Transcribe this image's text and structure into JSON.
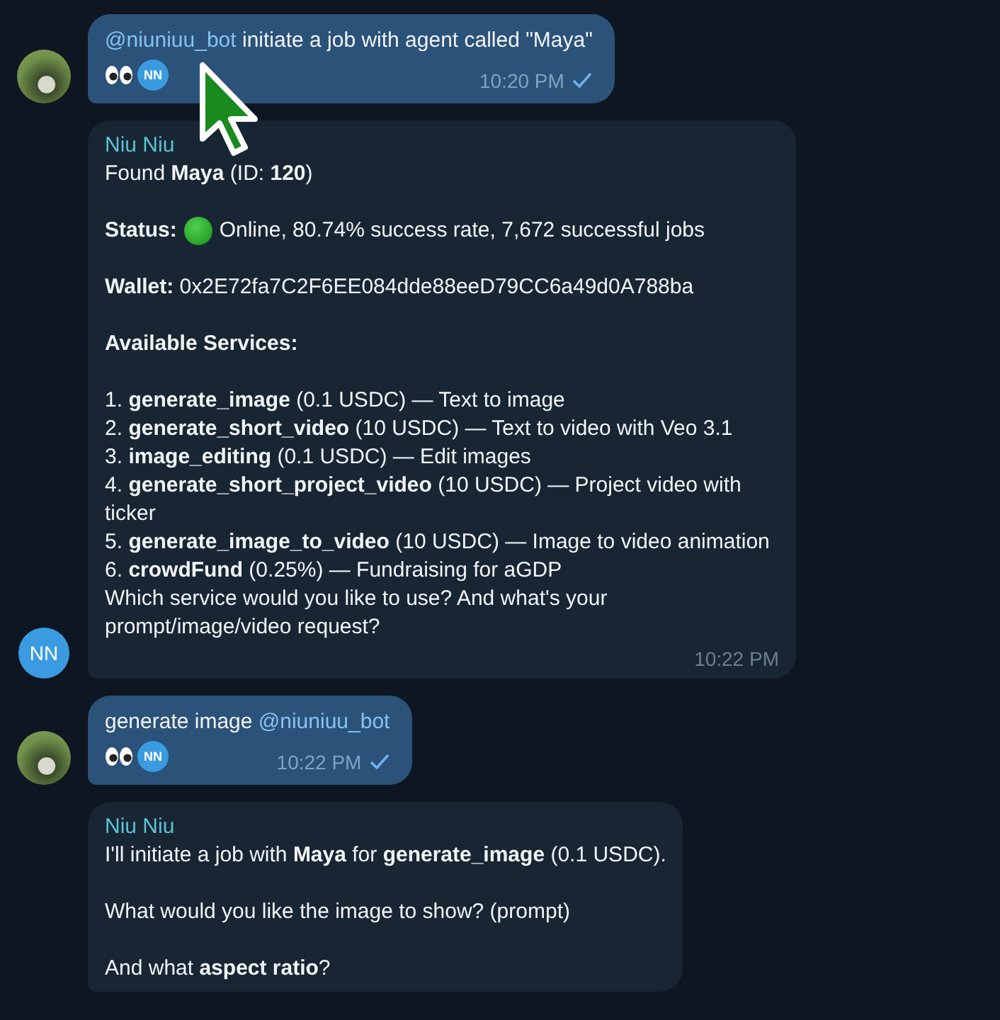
{
  "messages": [
    {
      "kind": "outgoing",
      "has_avatar": true,
      "parts": [
        {
          "kind": "mention",
          "text": "@niuniuu_bot"
        },
        {
          "kind": "plain",
          "text": " initiate a job with agent called \"Maya\""
        }
      ],
      "reactions": [
        {
          "kind": "eyes",
          "reactor": "NN"
        }
      ],
      "time": "10:20 PM",
      "read": false
    },
    {
      "kind": "incoming",
      "sender": "Niu Niu",
      "avatar": "NN",
      "blocks": [
        {
          "kind": "text",
          "lines": [
            "Found **Maya** (ID: **120**)"
          ]
        },
        {
          "kind": "status",
          "label": "Status:",
          "text": "Online, 80.74% success rate, 7,672 successful jobs"
        },
        {
          "kind": "text",
          "lines": [
            "**Wallet:** 0x2E72fa7C2F6EE084dde88eeD79CC6a49d0A788ba"
          ]
        },
        {
          "kind": "text",
          "lines": [
            "**Available Services:**"
          ]
        },
        {
          "kind": "text",
          "lines": [
            "1. **generate_image** (0.1 USDC) — Text to image",
            "2. **generate_short_video** (10 USDC) — Text to video with Veo 3.1",
            "3. **image_editing** (0.1 USDC) — Edit images",
            "4. **generate_short_project_video** (10 USDC) — Project video with ticker",
            "5. **generate_image_to_video** (10 USDC) — Image to video animation",
            "6. **crowdFund** (0.25%) — Fundraising for aGDP",
            "Which service would you like to use? And what's your prompt/image/video request?"
          ]
        }
      ],
      "time": "10:22 PM"
    },
    {
      "kind": "outgoing",
      "has_avatar": true,
      "parts": [
        {
          "kind": "plain",
          "text": "generate image "
        },
        {
          "kind": "mention",
          "text": "@niuniuu_bot"
        }
      ],
      "reactions": [
        {
          "kind": "eyes",
          "reactor": "NN"
        }
      ],
      "time": "10:22 PM",
      "read": false
    },
    {
      "kind": "incoming",
      "sender": "Niu Niu",
      "blocks": [
        {
          "kind": "text",
          "lines": [
            "I'll initiate a job with **Maya** for **generate_image** (0.1 USDC)."
          ]
        },
        {
          "kind": "text",
          "lines": [
            "What would you like the image to show? (prompt)"
          ]
        },
        {
          "kind": "text",
          "lines": [
            "And what **aspect ratio**?"
          ]
        }
      ]
    }
  ]
}
